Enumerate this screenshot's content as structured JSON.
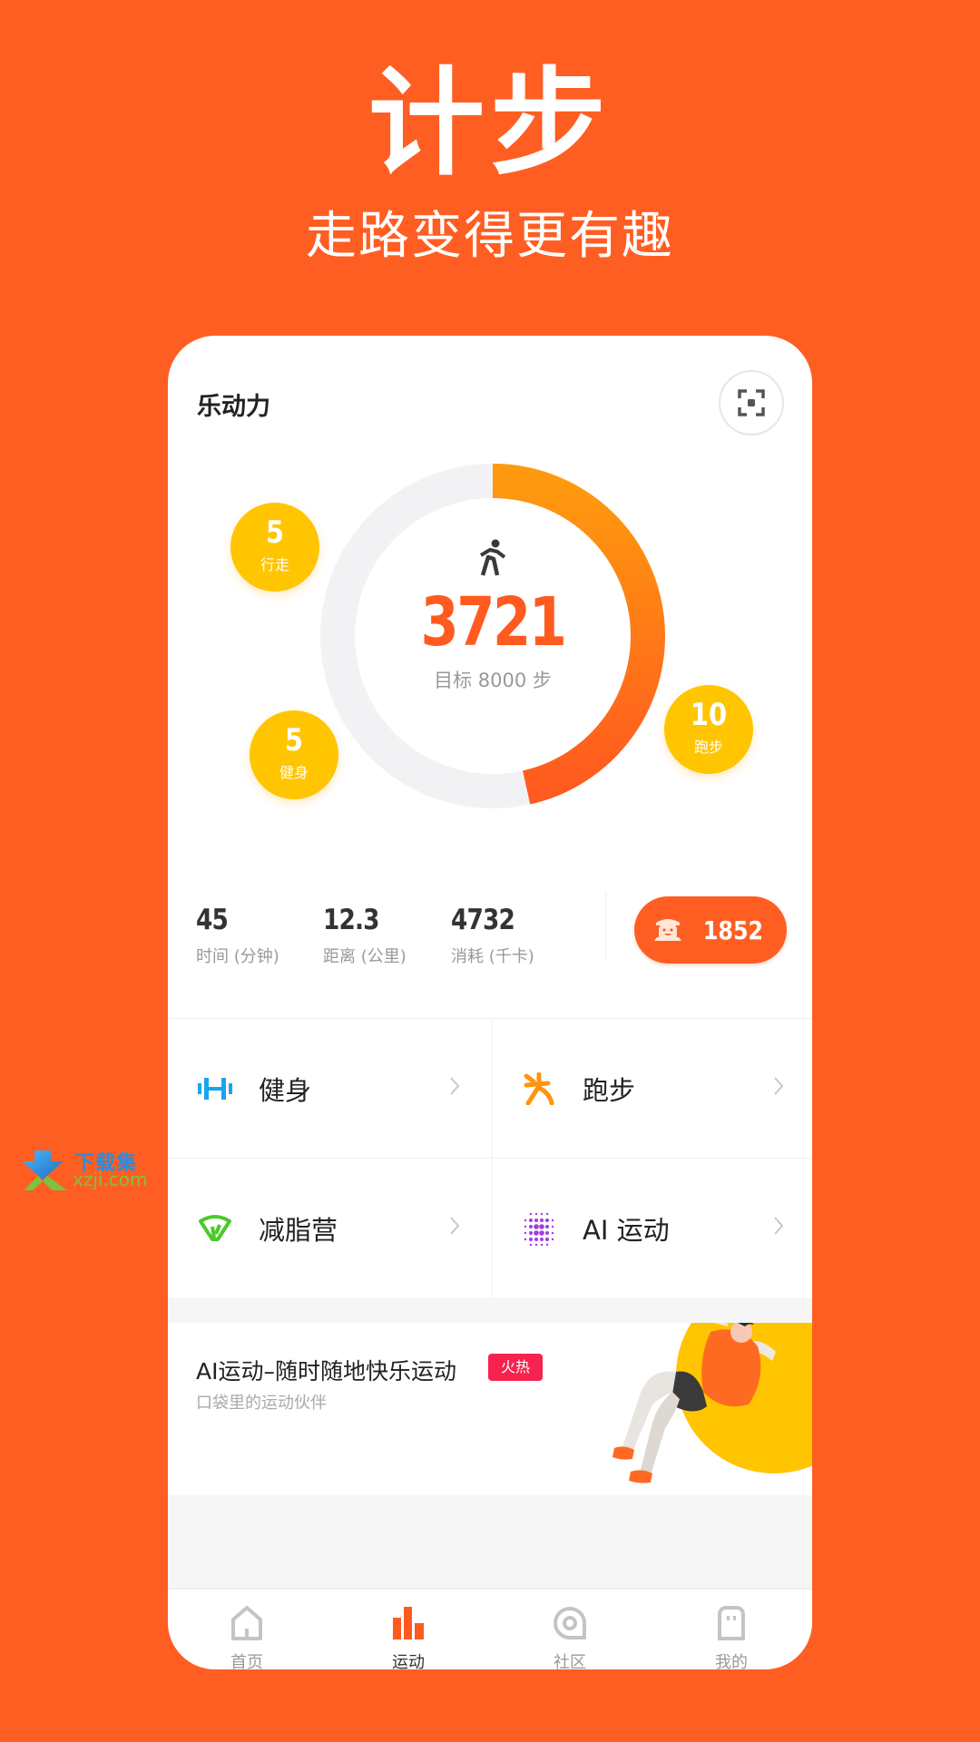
{
  "hero": {
    "title": "计步",
    "subtitle": "走路变得更有趣"
  },
  "watermark": {
    "line1": "下载集",
    "line2": "xzji.com"
  },
  "card": {
    "title": "乐动力",
    "scan_icon": "scan-icon",
    "ring": {
      "icon": "walking-icon",
      "steps": "3721",
      "goal_label": "目标 8000 步",
      "steps_value": 3721,
      "goal_value": 8000,
      "progress_fraction": 0.465,
      "track_color": "#F2F2F4",
      "progress_color_start": "#FF9A0E",
      "progress_color_end": "#FF5A1F"
    },
    "bubbles": [
      {
        "value": "5",
        "label": "行走"
      },
      {
        "value": "10",
        "label": "跑步"
      },
      {
        "value": "5",
        "label": "健身"
      }
    ],
    "stats": [
      {
        "value": "45",
        "label": "时间 (分钟)"
      },
      {
        "value": "12.3",
        "label": "距离 (公里)"
      },
      {
        "value": "4732",
        "label": "消耗 (千卡)"
      }
    ],
    "coin": {
      "icon": "mascot-icon",
      "value": "1852"
    },
    "grid": [
      {
        "label": "健身",
        "icon": "dumbbell-icon",
        "color": "#1AA3F0"
      },
      {
        "label": "跑步",
        "icon": "running-icon",
        "color": "#FF9410"
      },
      {
        "label": "减脂营",
        "icon": "fat-burn-icon",
        "color": "#4CC928"
      },
      {
        "label": "AI 运动",
        "icon": "ai-dots-icon",
        "color": "#A23CE0"
      }
    ],
    "banner": {
      "title": "AI运动–随时随地快乐运动",
      "badge": "火热",
      "subtitle": "口袋里的运动伙伴"
    },
    "tabs": [
      {
        "label": "首页",
        "icon": "home-icon",
        "active": false
      },
      {
        "label": "运动",
        "icon": "bar-chart-icon",
        "active": true
      },
      {
        "label": "社区",
        "icon": "community-icon",
        "active": false
      },
      {
        "label": "我的",
        "icon": "profile-icon",
        "active": false
      }
    ]
  },
  "colors": {
    "brand": "#FF5E22",
    "bubble": "#FFC500",
    "badge": "#F5234E"
  }
}
